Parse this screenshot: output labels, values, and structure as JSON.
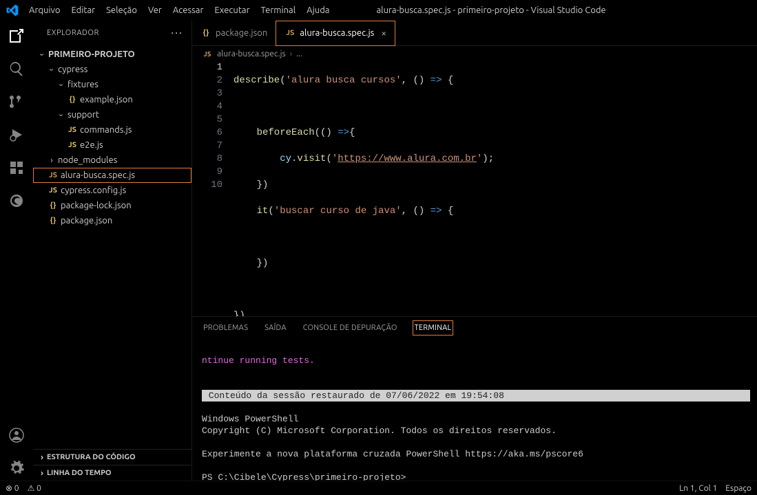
{
  "menubar": {
    "items": [
      "Arquivo",
      "Editar",
      "Seleção",
      "Ver",
      "Acessar",
      "Executar",
      "Terminal",
      "Ajuda"
    ],
    "title": "alura-busca.spec.js - primeiro-projeto - Visual Studio Code"
  },
  "sidebar": {
    "title": "EXPLORADOR",
    "project": "PRIMEIRO-PROJETO",
    "tree": {
      "cypress": "cypress",
      "fixtures": "fixtures",
      "example_json": "example.json",
      "support": "support",
      "commands_js": "commands.js",
      "e2e_js": "e2e.js",
      "node_modules": "node_modules",
      "alura_spec": "alura-busca.spec.js",
      "cypress_config": "cypress.config.js",
      "package_lock": "package-lock.json",
      "package_json": "package.json"
    },
    "outline": "ESTRUTURA DO CÓDIGO",
    "timeline": "LINHA DO TEMPO"
  },
  "tabs": {
    "package_json": "package.json",
    "alura_spec": "alura-busca.spec.js"
  },
  "breadcrumb": {
    "file": "alura-busca.spec.js",
    "rest": "..."
  },
  "code": {
    "l1a": "describe",
    "l1b": "(",
    "l1c": "'alura busca cursos'",
    "l1d": ", () ",
    "l1e": "=>",
    "l1f": " {",
    "l2": "",
    "l3a": "    beforeEach",
    "l3b": "(() ",
    "l3c": "=>",
    "l3d": "{",
    "l4a": "        cy",
    "l4b": ".",
    "l4c": "visit",
    "l4d": "(",
    "l4e": "'",
    "l4url": "https://www.alura.com.br",
    "l4f": "'",
    "l4g": ");",
    "l5": "    })",
    "l6a": "    it",
    "l6b": "(",
    "l6c": "'buscar curso de java'",
    "l6d": ", () ",
    "l6e": "=>",
    "l6f": " {",
    "l7": "",
    "l8": "    })",
    "l9": "",
    "l10": "})"
  },
  "line_numbers": [
    "1",
    "2",
    "3",
    "4",
    "5",
    "6",
    "7",
    "8",
    "9",
    "10"
  ],
  "panel": {
    "tabs": {
      "problems": "PROBLEMAS",
      "output": "SAÍDA",
      "debug": "CONSOLE DE DEPURAÇÃO",
      "terminal": "TERMINAL"
    },
    "term_line1": "ntinue running tests.",
    "term_restore": " Conteúdo da sessão restaurado de 07/06/2022 em 19:54:08 ",
    "term_ps1": "Windows PowerShell",
    "term_ps2": "Copyright (C) Microsoft Corporation. Todos os direitos reservados.",
    "term_ps3": "Experimente a nova plataforma cruzada PowerShell https://aka.ms/pscore6",
    "term_prompt": "PS C:\\Cibele\\Cypress\\primeiro-projeto>"
  },
  "statusbar": {
    "left1": "⊗ 0",
    "left2": "⚠ 0",
    "right_pos": "Ln 1, Col 1",
    "right_spaces": "Espaço"
  }
}
